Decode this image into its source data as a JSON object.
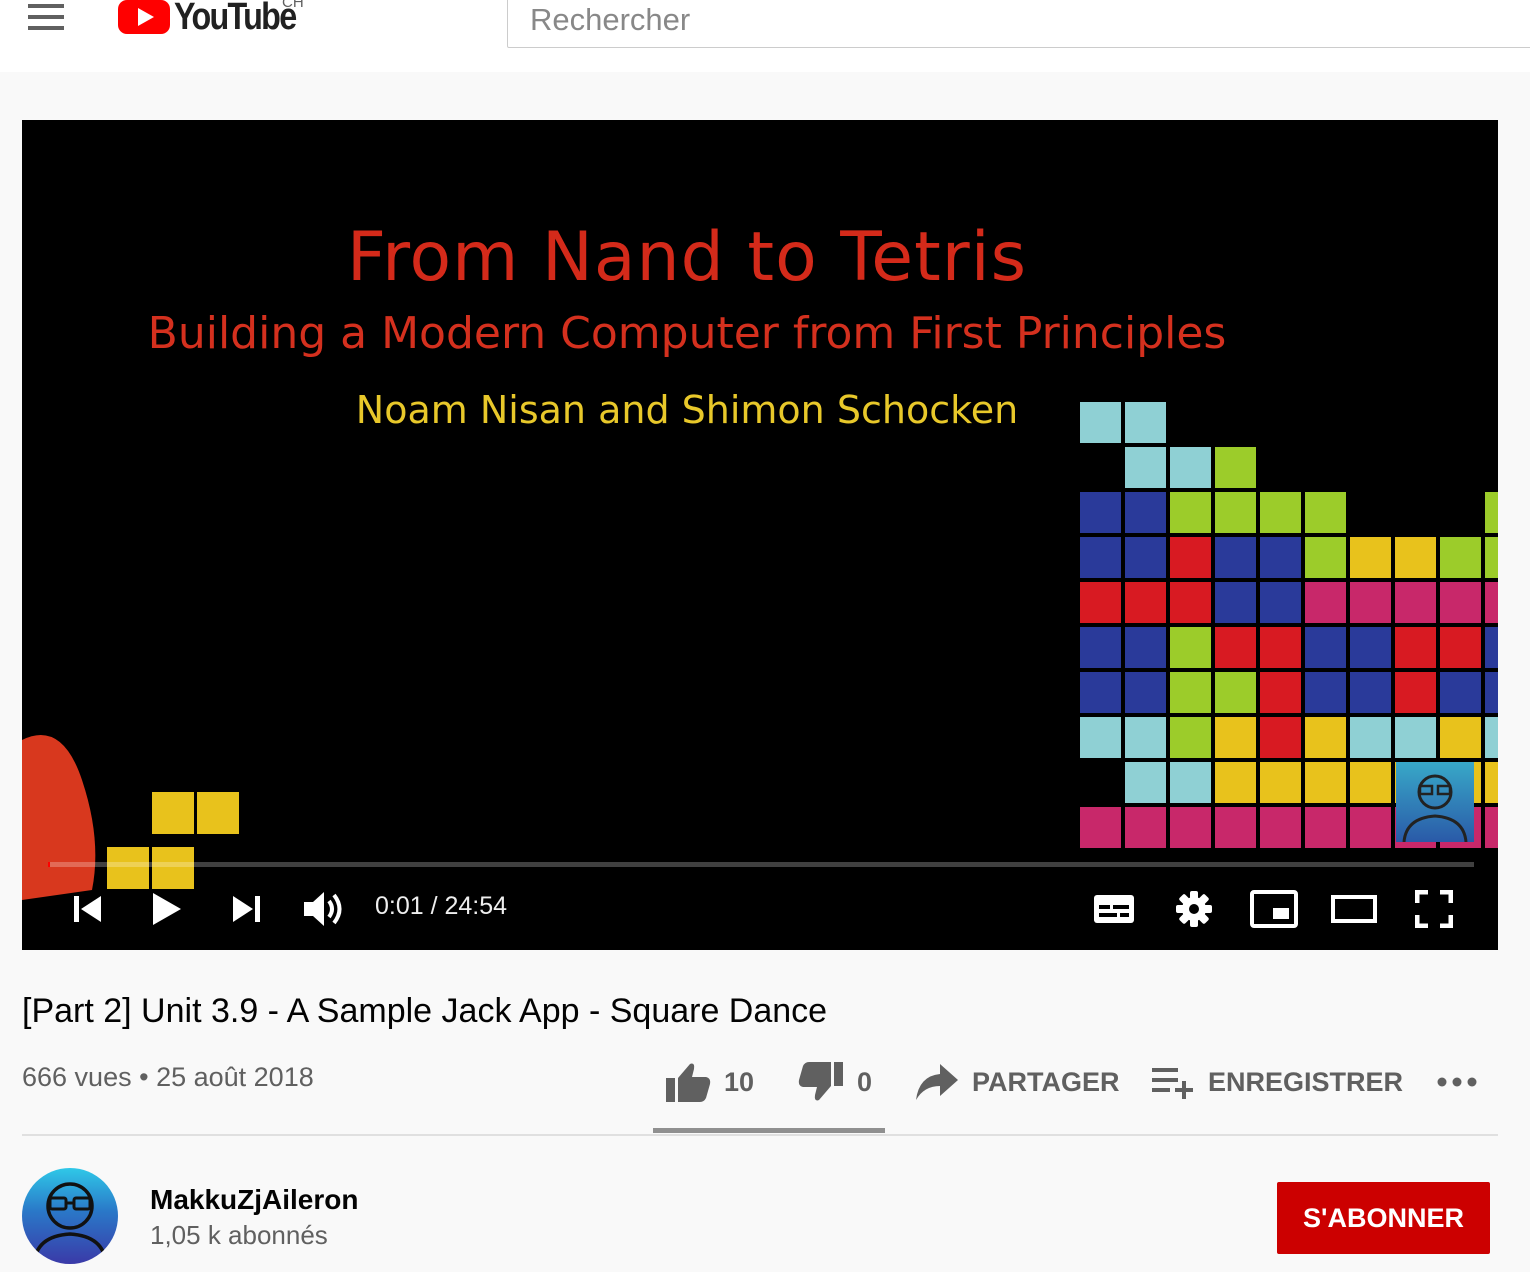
{
  "header": {
    "logo_text": "YouTube",
    "country": "CH",
    "search_placeholder": "Rechercher"
  },
  "player": {
    "slide": {
      "title": "From Nand to Tetris",
      "subtitle": "Building a Modern Computer from First Principles",
      "authors": "Noam Nisan and Shimon Schocken"
    },
    "time": "0:01 / 24:54",
    "progress_fraction": 0.0007
  },
  "video": {
    "title": "[Part 2] Unit 3.9 - A Sample Jack App - Square Dance",
    "views": "666 vues",
    "separator": "•",
    "date": "25 août 2018"
  },
  "actions": {
    "likes": "10",
    "dislikes": "0",
    "share_label": "PARTAGER",
    "save_label": "ENREGISTRER"
  },
  "channel": {
    "name": "MakkuZjAileron",
    "subscribers": "1,05 k abonnés",
    "subscribe_label": "S'ABONNER"
  },
  "colors": {
    "brand_red": "#ff0000",
    "subscribe_red": "#cc0000",
    "slide_title": "#d42a1a",
    "slide_authors": "#e8c82a"
  },
  "icons": [
    "menu-icon",
    "youtube-play-icon",
    "skip-previous-icon",
    "play-icon",
    "skip-next-icon",
    "volume-icon",
    "subtitles-icon",
    "settings-icon",
    "miniplayer-icon",
    "theater-icon",
    "fullscreen-icon",
    "thumbs-up-icon",
    "thumbs-down-icon",
    "share-icon",
    "playlist-add-icon",
    "more-icon"
  ]
}
